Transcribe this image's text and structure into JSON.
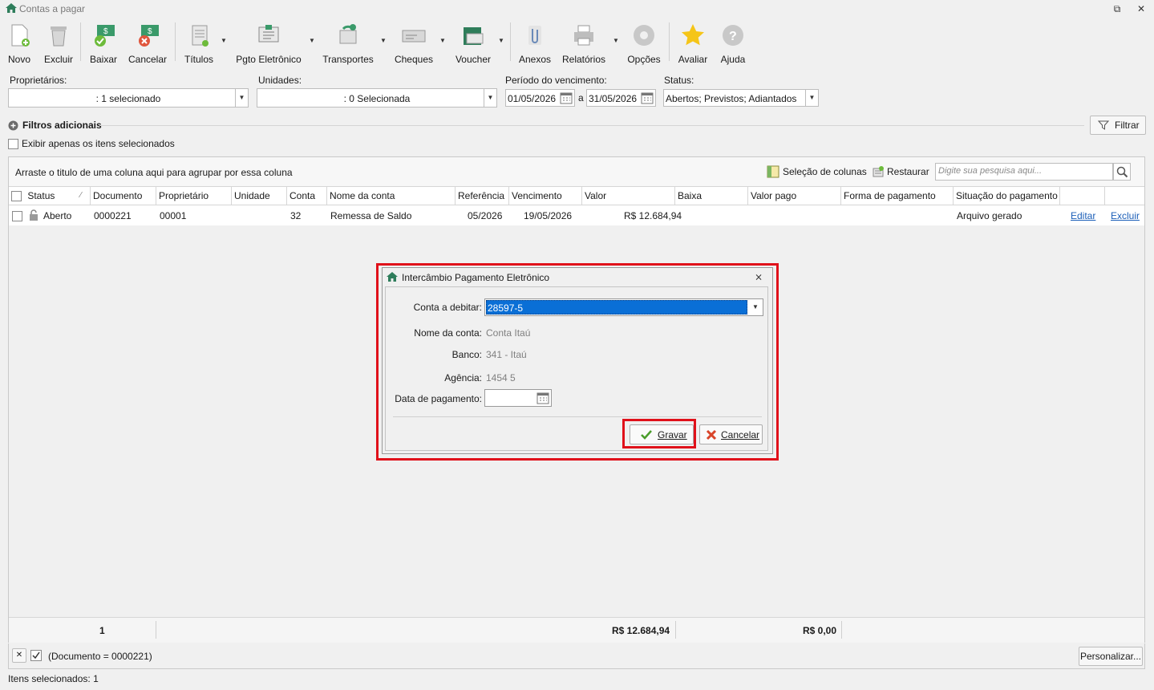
{
  "window": {
    "title": "Contas a pagar"
  },
  "toolbar": {
    "novo": "Novo",
    "excluir": "Excluir",
    "baixar": "Baixar",
    "cancelar": "Cancelar",
    "titulos": "Títulos",
    "pgto_eletronico": "Pgto Eletrônico",
    "transportes": "Transportes",
    "cheques": "Cheques",
    "voucher": "Voucher",
    "anexos": "Anexos",
    "relatorios": "Relatórios",
    "opcoes": "Opções",
    "avaliar": "Avaliar",
    "ajuda": "Ajuda"
  },
  "filters": {
    "proprietarios_label": "Proprietários:",
    "proprietarios_value": ": 1 selecionado",
    "unidades_label": "Unidades:",
    "unidades_value": ": 0 Selecionada",
    "periodo_label": "Período do vencimento:",
    "date_from": "01/05/2026",
    "date_sep": "a",
    "date_to": "31/05/2026",
    "status_label": "Status:",
    "status_value": "Abertos; Previstos; Adiantados",
    "filtros_adicionais": "Filtros adicionais",
    "filtrar_button": "Filtrar",
    "exibir_apenas": "Exibir apenas os itens selecionados"
  },
  "grid": {
    "group_hint": "Arraste o titulo de uma coluna aqui para agrupar por essa coluna",
    "selecao_colunas": "Seleção de colunas",
    "restaurar": "Restaurar",
    "search_placeholder": "Digite sua pesquisa aqui...",
    "columns": [
      "Status",
      "Documento",
      "Proprietário",
      "Unidade",
      "Conta",
      "Nome da conta",
      "Referência",
      "Vencimento",
      "Valor",
      "Baixa",
      "Valor pago",
      "Forma de pagamento",
      "Situação do pagamento"
    ],
    "rows": [
      {
        "status": "Aberto",
        "documento": "0000221",
        "proprietario": "00001",
        "unidade": "",
        "conta": "32",
        "nome_conta": "Remessa de Saldo",
        "referencia": "05/2026",
        "vencimento": "19/05/2026",
        "valor": "R$ 12.684,94",
        "baixa": "",
        "valor_pago": "",
        "forma_pagamento": "",
        "situacao": "Arquivo gerado",
        "editar": "Editar",
        "excluir": "Excluir"
      }
    ],
    "footer": {
      "count": "1",
      "valor_total": "R$ 12.684,94",
      "valor_pago_total": "R$ 0,00"
    }
  },
  "filterbar": {
    "expression": "(Documento = 0000221)",
    "personalizar": "Personalizar..."
  },
  "statusbar": {
    "itens_selecionados": "Itens selecionados: 1"
  },
  "dialog": {
    "title": "Intercâmbio Pagamento Eletrônico",
    "conta_debitar_label": "Conta a debitar:",
    "conta_debitar_value": "28597-5",
    "nome_conta_label": "Nome da conta:",
    "nome_conta_value": "Conta Itaú",
    "banco_label": "Banco:",
    "banco_value": "341 - Itaú",
    "agencia_label": "Agência:",
    "agencia_value": "1454 5",
    "data_pagamento_label": "Data de pagamento:",
    "data_pagamento_value": "",
    "gravar": "Gravar",
    "cancelar": "Cancelar"
  }
}
